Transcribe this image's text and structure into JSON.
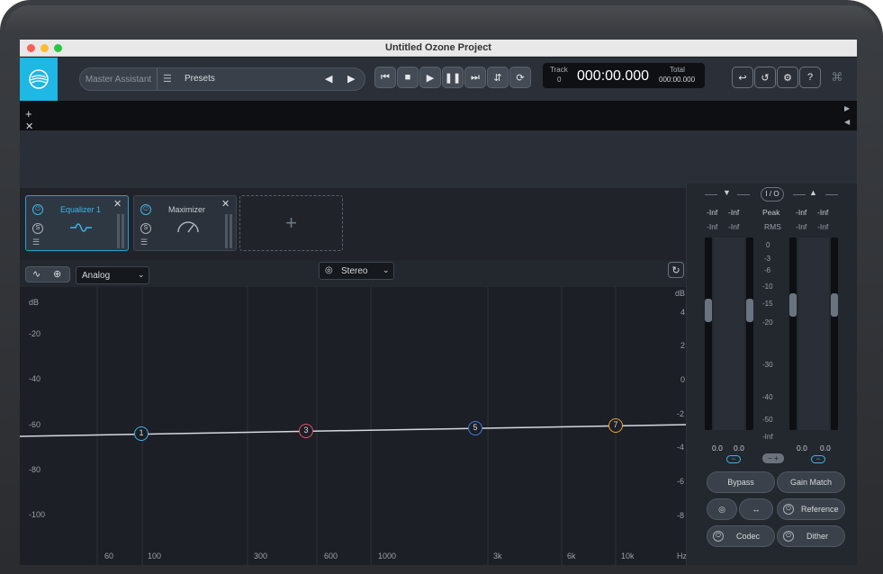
{
  "window": {
    "title": "Untitled Ozone Project"
  },
  "toolbar": {
    "master_assistant": "Master Assistant",
    "presets": "Presets",
    "track_label": "Track",
    "track_value": "0",
    "time": "000:00.000",
    "total_label": "Total",
    "total_value": "000:00.000"
  },
  "modules": [
    {
      "name": "Equalizer 1",
      "selected": true
    },
    {
      "name": "Maximizer",
      "selected": false
    }
  ],
  "eq": {
    "mode": "Analog",
    "channel": "Stereo",
    "db_label_left": "dB",
    "db_label_right": "dB",
    "left_scale": [
      "-20",
      "-40",
      "-60",
      "-80",
      "-100"
    ],
    "right_scale": [
      "4",
      "2",
      "0",
      "-2",
      "-4",
      "-6",
      "-8"
    ],
    "freq_labels": [
      "60",
      "100",
      "300",
      "600",
      "1000",
      "3k",
      "6k",
      "10k",
      "Hz"
    ],
    "nodes": [
      {
        "label": "1",
        "color": "#3fb4e8"
      },
      {
        "label": "3",
        "color": "#e8506a"
      },
      {
        "label": "5",
        "color": "#3a7de8"
      },
      {
        "label": "7",
        "color": "#f0a13a"
      }
    ]
  },
  "meters": {
    "io_label": "I / O",
    "peak_label": "Peak",
    "rms_label": "RMS",
    "in_peak": [
      "-Inf",
      "-Inf"
    ],
    "in_rms": [
      "-Inf",
      "-Inf"
    ],
    "out_peak": [
      "-Inf",
      "-Inf"
    ],
    "out_rms": [
      "-Inf",
      "-Inf"
    ],
    "scale": [
      "0",
      "-3",
      "-6",
      "-10",
      "-15",
      "-20",
      "-30",
      "-40",
      "-50",
      "-Inf"
    ],
    "in_gain": [
      "0.0",
      "0.0"
    ],
    "out_gain": [
      "0.0",
      "0.0"
    ],
    "bypass": "Bypass",
    "gain_match": "Gain Match",
    "reference": "Reference",
    "codec": "Codec",
    "dither": "Dither"
  }
}
